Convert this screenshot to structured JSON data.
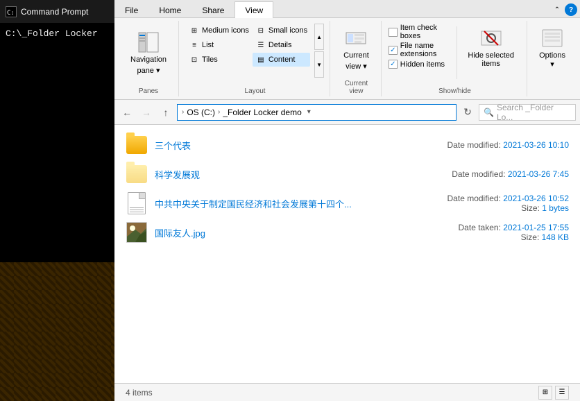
{
  "cmdPanel": {
    "title": "Command Prompt",
    "prompt": "C:\\_Folder Locker"
  },
  "ribbon": {
    "tabs": [
      {
        "id": "file",
        "label": "File"
      },
      {
        "id": "home",
        "label": "Home"
      },
      {
        "id": "share",
        "label": "Share"
      },
      {
        "id": "view",
        "label": "View",
        "active": true
      }
    ],
    "panes": {
      "groupLabel": "Panes",
      "navPane": {
        "label": "Navigation\npane",
        "dropArrow": "▾"
      }
    },
    "layout": {
      "groupLabel": "Layout",
      "items": [
        {
          "label": "Medium icons",
          "active": false
        },
        {
          "label": "Small icons",
          "active": false
        },
        {
          "label": "List",
          "active": false
        },
        {
          "label": "Details",
          "active": false
        },
        {
          "label": "Tiles",
          "active": false
        },
        {
          "label": "Content",
          "active": true
        }
      ]
    },
    "currentView": {
      "groupLabel": "Current view",
      "label": "Current\nview",
      "dropArrow": "▾"
    },
    "showHide": {
      "groupLabel": "Show/hide",
      "itemCheckboxes": {
        "label": "Item check boxes",
        "checked": false
      },
      "fileNameExtensions": {
        "label": "File name extensions",
        "checked": true
      },
      "hiddenItems": {
        "label": "Hidden items",
        "checked": true
      }
    },
    "hideSelected": {
      "label": "Hide selected\nitems"
    },
    "options": {
      "label": "Options",
      "dropArrow": "▾"
    }
  },
  "addressBar": {
    "backDisabled": false,
    "forwardDisabled": true,
    "upLabel": "↑",
    "breadcrumb": {
      "root": "OS (C:)",
      "arrow": "›",
      "folder": "_Folder Locker demo"
    },
    "searchPlaceholder": "Search _Folder Lo..."
  },
  "fileList": {
    "items": [
      {
        "name": "三个代表",
        "type": "folder",
        "metaLabel": "Date modified:",
        "metaDate": "2021-03-26",
        "metaTime": "10:10",
        "metaExtra": null
      },
      {
        "name": "科学发展观",
        "type": "folder-light",
        "metaLabel": "Date modified:",
        "metaDate": "2021-03-26",
        "metaTime": "7:45",
        "metaExtra": null
      },
      {
        "name": "中共中央关于制定国民经济和社会发展第十四个...",
        "type": "document",
        "metaLabel": "Date modified:",
        "metaDate": "2021-03-26",
        "metaTime": "10:52",
        "sizeLabel": "Size:",
        "sizeValue": "1 bytes"
      },
      {
        "name": "国际友人.jpg",
        "type": "image",
        "metaLabel": "Date taken:",
        "metaDate": "2021-01-25",
        "metaTime": "17:55",
        "sizeLabel": "Size:",
        "sizeValue": "148 KB"
      }
    ]
  },
  "statusBar": {
    "count": "4 items"
  }
}
